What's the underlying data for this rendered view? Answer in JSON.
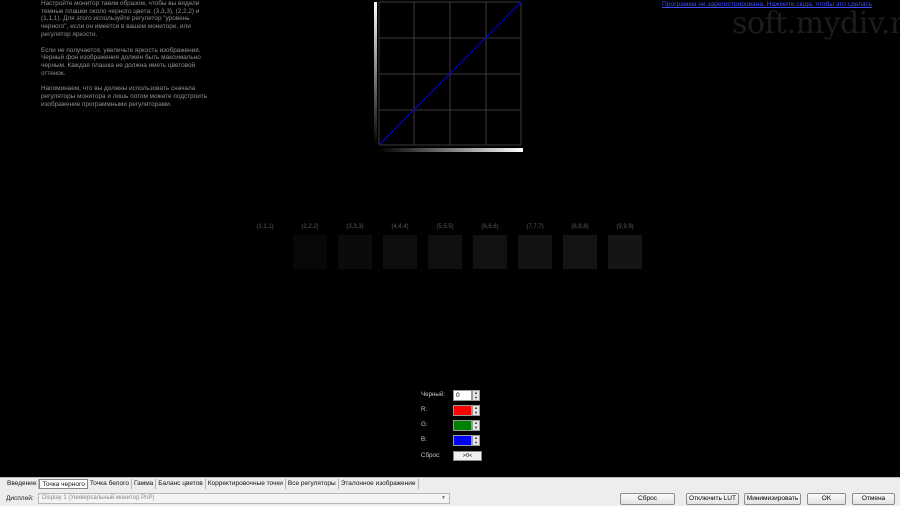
{
  "help": {
    "paragraph1": "Настройте монитор таким образом, чтобы вы видели темные плашки около черного цвета: (3,3,3), (2,2,2) и (1,1,1). Для этого используйте регулятор \"уровень черного\", если он имеется в вашем мониторе, или регулятор яркости.",
    "paragraph2": "Если не получается, увеличьте яркость изображения. Черный фон изображения должен быть максимально черным. Каждая плашка не должна иметь цветовой оттенок.",
    "paragraph3": "Напоминаем, что вы должны использовать сначала регуляторы монитора и лишь потом можете подстроить изображение программными регуляторами."
  },
  "registration_link": "Программа не зарегистрирована. Нажмите сюда, чтобы это сделать",
  "watermark": "soft.mydiv.net",
  "patches": [
    {
      "label": "(1,1,1)",
      "color": "#010101"
    },
    {
      "label": "(2,2,2)",
      "color": "#080808"
    },
    {
      "label": "(3,3,3)",
      "color": "#0b0b0b"
    },
    {
      "label": "(4,4,4)",
      "color": "#0e0e0e"
    },
    {
      "label": "(5,5,5)",
      "color": "#101010"
    },
    {
      "label": "(6,6,6)",
      "color": "#121212"
    },
    {
      "label": "(7,7,7)",
      "color": "#131313"
    },
    {
      "label": "(8,8,8)",
      "color": "#141414"
    },
    {
      "label": "(9,9,9)",
      "color": "#151515"
    }
  ],
  "controls": {
    "black_label": "Черный:",
    "black_value": "0",
    "r_label": "R:",
    "r_color": "#ff0000",
    "g_label": "G:",
    "g_color": "#008000",
    "b_label": "B:",
    "b_color": "#0000ff",
    "reset_label": "Сброс:",
    "reset_button": ">0<"
  },
  "tabs": [
    {
      "label": "Введение",
      "active": false
    },
    {
      "label": "Точка черного",
      "active": true
    },
    {
      "label": "Точка белого",
      "active": false
    },
    {
      "label": "Гамма",
      "active": false
    },
    {
      "label": "Баланс цветов",
      "active": false
    },
    {
      "label": "Корректировочные точки",
      "active": false
    },
    {
      "label": "Все регуляторы",
      "active": false
    },
    {
      "label": "Эталонное изображение",
      "active": false
    }
  ],
  "display": {
    "label": "Дисплей:",
    "value": "Display 1 (Универсальный монитор PnP)"
  },
  "buttons": {
    "reset": "Сброс",
    "disable_lut": "Отключить LUT",
    "minimize": "Минимизировать",
    "ok": "OK",
    "cancel": "Отмена"
  },
  "colors": {
    "background": "#000000",
    "curve": "#0000cc",
    "link": "#3a4cff"
  }
}
